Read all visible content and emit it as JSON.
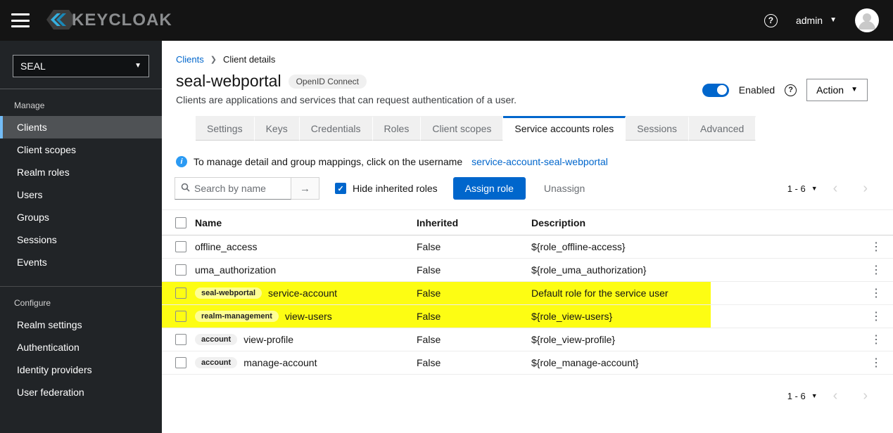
{
  "colors": {
    "accent_blue": "#0066cc",
    "link_blue": "#0066cc",
    "nav_active_border": "#73bcf7",
    "highlight_yellow": "#fdfd13",
    "topbar_bg": "#141414",
    "sidebar_bg": "#212427"
  },
  "topbar": {
    "brand": "KEYCLOAK",
    "user": "admin"
  },
  "sidebar": {
    "realm": "SEAL",
    "sections": [
      {
        "label": "Manage",
        "items": [
          {
            "label": "Clients"
          },
          {
            "label": "Client scopes"
          },
          {
            "label": "Realm roles"
          },
          {
            "label": "Users"
          },
          {
            "label": "Groups"
          },
          {
            "label": "Sessions"
          },
          {
            "label": "Events"
          }
        ]
      },
      {
        "label": "Configure",
        "items": [
          {
            "label": "Realm settings"
          },
          {
            "label": "Authentication"
          },
          {
            "label": "Identity providers"
          },
          {
            "label": "User federation"
          }
        ]
      }
    ]
  },
  "breadcrumb": {
    "link": "Clients",
    "current": "Client details"
  },
  "header": {
    "title": "seal-webportal",
    "badge": "OpenID Connect",
    "subtitle": "Clients are applications and services that can request authentication of a user.",
    "enabled_label": "Enabled",
    "action_label": "Action"
  },
  "tabs": [
    {
      "label": "Settings"
    },
    {
      "label": "Keys"
    },
    {
      "label": "Credentials"
    },
    {
      "label": "Roles"
    },
    {
      "label": "Client scopes"
    },
    {
      "label": "Service accounts roles"
    },
    {
      "label": "Sessions"
    },
    {
      "label": "Advanced"
    }
  ],
  "info": {
    "text": "To manage detail and group mappings, click on the username",
    "link": "service-account-seal-webportal"
  },
  "toolbar": {
    "search_placeholder": "Search by name",
    "hide_inherited_label": "Hide inherited roles",
    "assign_label": "Assign role",
    "unassign_label": "Unassign",
    "pagination": "1 - 6"
  },
  "table": {
    "columns": [
      "Name",
      "Inherited",
      "Description"
    ],
    "rows": [
      {
        "badge": "",
        "name": "offline_access",
        "inherited": "False",
        "description": "${role_offline-access}"
      },
      {
        "badge": "",
        "name": "uma_authorization",
        "inherited": "False",
        "description": "${role_uma_authorization}"
      },
      {
        "badge": "seal-webportal",
        "name": "service-account",
        "inherited": "False",
        "description": "Default role for the service user"
      },
      {
        "badge": "realm-management",
        "name": "view-users",
        "inherited": "False",
        "description": "${role_view-users}"
      },
      {
        "badge": "account",
        "name": "view-profile",
        "inherited": "False",
        "description": "${role_view-profile}"
      },
      {
        "badge": "account",
        "name": "manage-account",
        "inherited": "False",
        "description": "${role_manage-account}"
      }
    ]
  },
  "footer": {
    "pagination": "1 - 6"
  }
}
